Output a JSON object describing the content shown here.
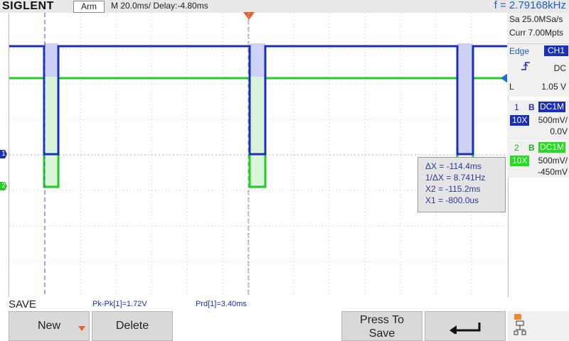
{
  "header": {
    "brand": "SIGLENT",
    "acq_state": "Arm",
    "timebase": "M 20.0ms/ Delay:-4.80ms",
    "frequency": "f = 2.79168kHz"
  },
  "acquisition": {
    "sample_rate": "Sa 25.0MSa/s",
    "memory_depth": "Curr 7.00Mpts"
  },
  "trigger": {
    "type": "Edge",
    "source": "CH1",
    "coupling": "DC",
    "level_prefix": "L",
    "level": "1.05 V"
  },
  "channels": [
    {
      "number": "1",
      "bw": "B",
      "coupling": "DC1M",
      "probe": "10X",
      "scale": "500mV/",
      "offset": "0.0V",
      "color": "#1a2fb8"
    },
    {
      "number": "2",
      "bw": "B",
      "coupling": "DC1M",
      "probe": "10X",
      "scale": "500mV/",
      "offset": "-450mV",
      "color": "#22cc22"
    }
  ],
  "cursor_readout": {
    "dx": "ΔX = -114.4ms",
    "inv_dx": "1/ΔX = 8.741Hz",
    "x2": "X2 = -115.2ms",
    "x1": "X1 = -800.0us"
  },
  "measurements": {
    "menu_title": "SAVE",
    "pkpk": "Pk-Pk[1]=1.72V",
    "prd": "Prd[1]=3.40ms"
  },
  "softkeys": {
    "new": "New",
    "delete": "Delete",
    "press_line1": "Press To",
    "press_line2": "Save",
    "back_icon": "return-arrow-icon",
    "network_icon": "network-icon"
  },
  "markers": {
    "ch1": "1",
    "ch2": "2"
  }
}
